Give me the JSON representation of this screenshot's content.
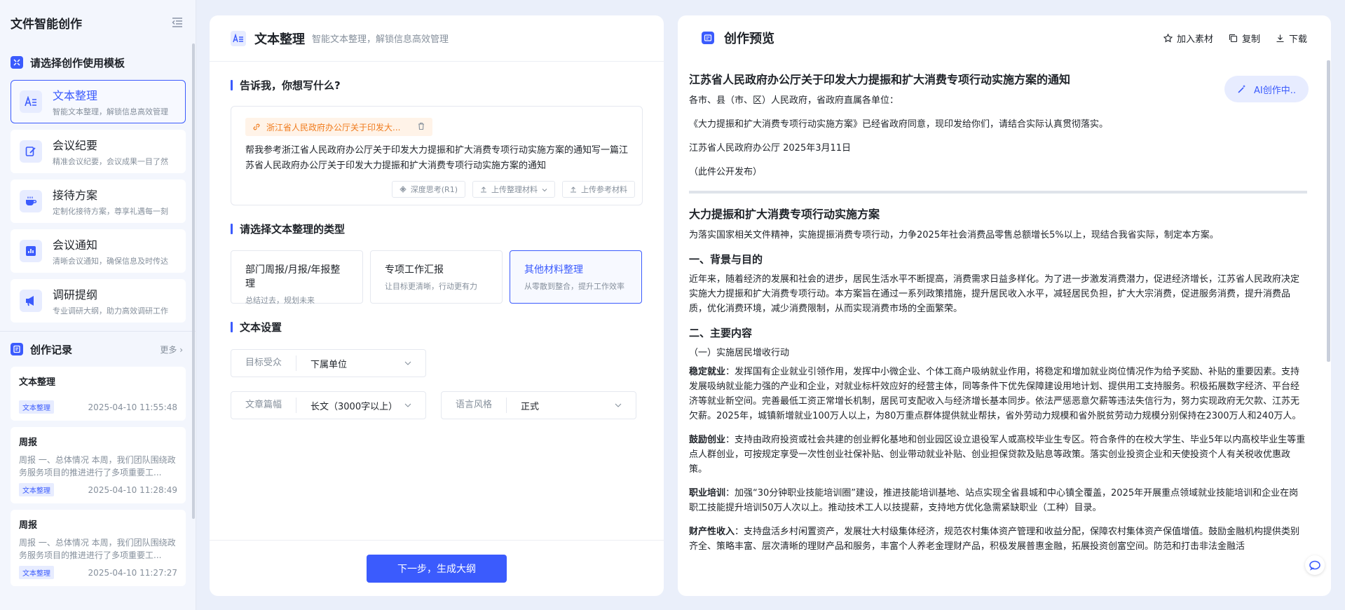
{
  "app": {
    "title": "文件智能创作"
  },
  "sidebar": {
    "template_section_label": "请选择创作使用模板",
    "templates": [
      {
        "title": "文本整理",
        "desc": "智能文本整理，解锁信息高效管理",
        "icon": "text-format-icon"
      },
      {
        "title": "会议纪要",
        "desc": "精准会议纪要，会议成果一目了然",
        "icon": "edit-note-icon"
      },
      {
        "title": "接待方案",
        "desc": "定制化接待方案，尊享礼遇每一刻",
        "icon": "coffee-cup-icon"
      },
      {
        "title": "会议通知",
        "desc": "清晰会议通知，确保信息及时传达",
        "icon": "bar-chart-icon"
      },
      {
        "title": "调研提纲",
        "desc": "专业调研大纲，助力高效调研工作",
        "icon": "megaphone-icon"
      }
    ],
    "records_label": "创作记录",
    "records_more": "更多",
    "records": [
      {
        "title": "文本整理",
        "snippet": "",
        "tag": "文本整理",
        "time": "2025-04-10 11:55:48"
      },
      {
        "title": "周报",
        "snippet": "周报 一、总体情况 本周，我们团队围绕政务服务项目的推进进行了多项重要工...",
        "tag": "文本整理",
        "time": "2025-04-10 11:28:49"
      },
      {
        "title": "周报",
        "snippet": "周报 一、总体情况 本周，我们团队围绕政务服务项目的推进进行了多项重要工...",
        "tag": "文本整理",
        "time": "2025-04-10 11:27:27"
      }
    ]
  },
  "middle": {
    "title": "文本整理",
    "subtitle": "智能文本整理，解锁信息高效管理",
    "ask_label": "告诉我，你想写什么?",
    "file_chip": "浙江省人民政府办公厅关于印发大...",
    "prompt_text": "帮我参考浙江省人民政府办公厅关于印发大力提振和扩大消费专项行动实施方案的通知写一篇江苏省人民政府办公厅关于印发大力提振和扩大消费专项行动实施方案的通知",
    "tools": {
      "deep_think": "深度思考(R1)",
      "upload_material": "上传整理材料",
      "upload_ref": "上传参考材料"
    },
    "type_label": "请选择文本整理的类型",
    "types": [
      {
        "title": "部门周报/月报/年报整理",
        "desc": "总结过去，规划未来"
      },
      {
        "title": "专项工作汇报",
        "desc": "让目标更清晰，行动更有力"
      },
      {
        "title": "其他材料整理",
        "desc": "从零散到整合，提升工作效率"
      }
    ],
    "settings_label": "文本设置",
    "settings": {
      "audience_label": "目标受众",
      "audience_value": "下属单位",
      "length_label": "文章篇幅",
      "length_value": "长文（3000字以上）",
      "style_label": "语言风格",
      "style_value": "正式"
    },
    "next_button": "下一步，生成大纲"
  },
  "preview": {
    "title": "创作预览",
    "actions": {
      "add": "加入素材",
      "copy": "复制",
      "download": "下载"
    },
    "ai_badge": "AI创作中..",
    "doc": {
      "notice_title": "江苏省人民政府办公厅关于印发大力提振和扩大消费专项行动实施方案的通知",
      "addressee": "各市、县（市、区）人民政府，省政府直属各单位：",
      "body": "《大力提振和扩大消费专项行动实施方案》已经省政府同意，现印发给你们，请结合实际认真贯彻落实。",
      "signature": "江苏省人民政府办公厅 2025年3月11日",
      "disclosure": "（此件公开发布）",
      "plan_title": "大力提振和扩大消费专项行动实施方案",
      "intro": "为落实国家相关文件精神，实施提振消费专项行动，力争2025年社会消费品零售总额增长5%以上，现结合我省实际，制定本方案。",
      "sec1_title": "一、背景与目的",
      "sec1_body": "近年来，随着经济的发展和社会的进步，居民生活水平不断提高，消费需求日益多样化。为了进一步激发消费潜力，促进经济增长，江苏省人民政府决定实施大力提振和扩大消费专项行动。本方案旨在通过一系列政策措施，提升居民收入水平，减轻居民负担，扩大大宗消费，促进服务消费，提升消费品质，优化消费环境，减少消费限制，从而实现消费市场的全面繁荣。",
      "sec2_title": "二、主要内容",
      "sub1_title": "（一）实施居民增收行动",
      "p1_label": "稳定就业",
      "p1_text": "：发挥国有企业就业引领作用，发挥中小微企业、个体工商户吸纳就业作用，将稳定和增加就业岗位情况作为给予奖励、补贴的重要因素。支持发展吸纳就业能力强的产业和企业，对就业标杆效应好的经营主体，同等条件下优先保障建设用地计划、提供用工支持服务。积极拓展数字经济、平台经济等就业新空间。完善最低工资正常增长机制，居民可支配收入与经济增长基本同步。依法严惩恶意欠薪等违法失信行为，努力实现政府无欠款、江苏无欠薪。2025年，城镇新增就业100万人以上，为80万重点群体提供就业帮扶，省外劳动力规模和省外脱贫劳动力规模分别保持在2300万人和240万人。",
      "p2_label": "鼓励创业",
      "p2_text": "：支持由政府投资或社会共建的创业孵化基地和创业园区设立退役军人或高校毕业生专区。符合条件的在校大学生、毕业5年以内高校毕业生等重点人群创业，可按规定享受一次性创业社保补贴、创业带动就业补贴、创业担保贷款及贴息等政策。落实创业投资企业和天使投资个人有关税收优惠政策。",
      "p3_label": "职业培训",
      "p3_text": "：加强“30分钟职业技能培训圈”建设，推进技能培训基地、站点实现全省县城和中心镇全覆盖，2025年开展重点领域就业技能培训和企业在岗职工技能提升培训50万人次以上。推动技术工人以技提薪，支持地方优化急需紧缺职业（工种）目录。",
      "p4_label": "财产性收入",
      "p4_text": "：支持盘活乡村闲置资产，发展壮大村级集体经济，规范农村集体资产管理和收益分配，保障农村集体资产保值增值。鼓励金融机构提供类别齐全、策略丰富、层次清晰的理财产品和服务，丰富个人养老金理财产品，积极发展普惠金融，拓展投资创富空间。防范和打击非法金融活"
    }
  },
  "colors": {
    "accent": "#3b5bfd",
    "background": "#eaeffa",
    "chip_orange": "#f07b1d"
  }
}
